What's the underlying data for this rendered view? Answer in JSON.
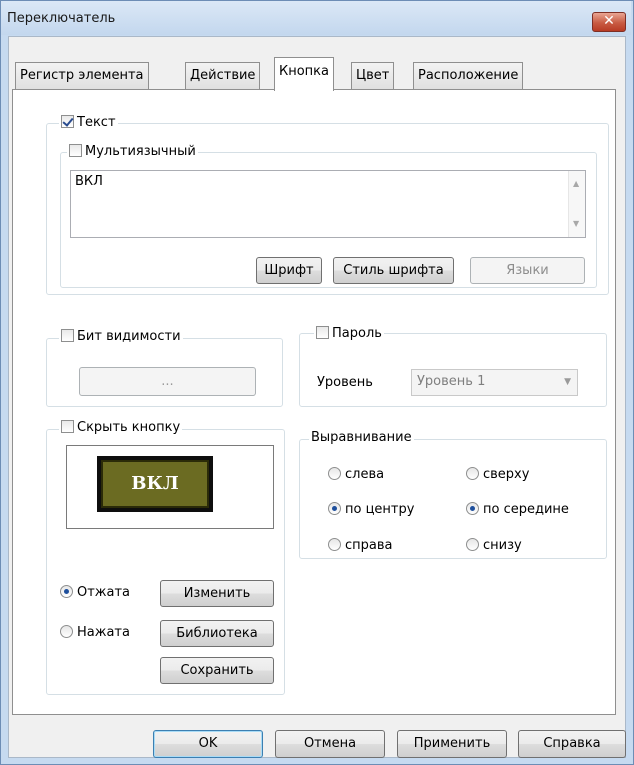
{
  "window": {
    "title": "Переключатель",
    "close": "✕"
  },
  "tabs": [
    {
      "label": "Регистр элемента"
    },
    {
      "label": "Действие"
    },
    {
      "label": "Кнопка"
    },
    {
      "label": "Цвет"
    },
    {
      "label": "Расположение"
    }
  ],
  "text_group": {
    "text_checkbox": "Текст",
    "multilang_checkbox": "Мультиязычный",
    "text_value": "ВКЛ",
    "font_button": "Шрифт",
    "font_style_button": "Стиль шрифта",
    "languages_button": "Языки"
  },
  "visibility": {
    "checkbox": "Бит видимости",
    "browse_button": "..."
  },
  "password": {
    "checkbox": "Пароль",
    "level_label": "Уровень",
    "level_value": "Уровень 1"
  },
  "hide_button": {
    "checkbox": "Скрыть кнопку",
    "preview_label": "ВКЛ",
    "state_released": "Отжата",
    "state_pressed": "Нажата",
    "change_button": "Изменить",
    "library_button": "Библиотека",
    "save_button": "Сохранить"
  },
  "alignment": {
    "title": "Выравнивание",
    "left": "слева",
    "center": "по центру",
    "right": "справа",
    "top": "сверху",
    "middle": "по середине",
    "bottom": "снизу"
  },
  "footer": {
    "ok": "OK",
    "cancel": "Отмена",
    "apply": "Применить",
    "help": "Справка"
  }
}
